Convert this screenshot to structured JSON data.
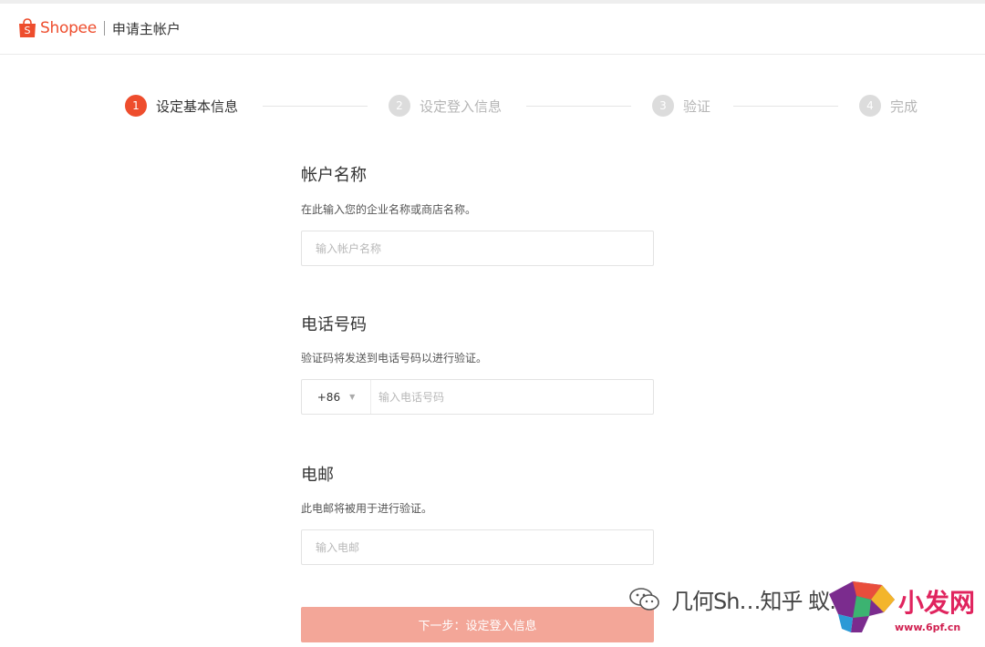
{
  "header": {
    "brand": "Shopee",
    "title": "申请主帐户"
  },
  "steps": [
    {
      "number": "1",
      "label": "设定基本信息",
      "active": true
    },
    {
      "number": "2",
      "label": "设定登入信息",
      "active": false
    },
    {
      "number": "3",
      "label": "验证",
      "active": false
    },
    {
      "number": "4",
      "label": "完成",
      "active": false
    }
  ],
  "form": {
    "account_name": {
      "title": "帐户名称",
      "description": "在此输入您的企业名称或商店名称。",
      "placeholder": "输入帐户名称",
      "value": ""
    },
    "phone": {
      "title": "电话号码",
      "description": "验证码将发送到电话号码以进行验证。",
      "country_code": "+86",
      "placeholder": "输入电话号码",
      "value": ""
    },
    "email": {
      "title": "电邮",
      "description": "此电邮将被用于进行验证。",
      "placeholder": "输入电邮",
      "value": ""
    },
    "next_button_label": "下一步：设定登入信息"
  },
  "watermark": {
    "text": "几何Sh…知乎 蚁…",
    "site_name": "小发网",
    "site_url": "www.6pf.cn"
  },
  "colors": {
    "accent": "#ee4d2d",
    "button_disabled": "#f3a698"
  }
}
